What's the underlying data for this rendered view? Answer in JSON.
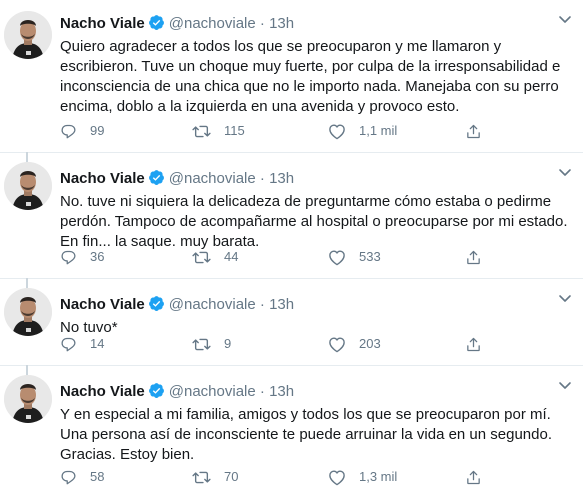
{
  "tweets": [
    {
      "name": "Nacho Viale",
      "handle": "@nachoviale",
      "dot": "·",
      "time": "13h",
      "text": "Quiero agradecer a todos los que se preocuparon y me llamaron y\nescribieron. Tuve un choque muy fuerte, por culpa de la irresponsabilidad e\ninconsciencia de una chica que no le importo nada. Manejaba con su perro\nencima, doblo a la izquierda en una avenida y provoco esto.",
      "replies": "99",
      "retweets": "115",
      "likes": "1,1 mil"
    },
    {
      "name": "Nacho Viale",
      "handle": "@nachoviale",
      "dot": "·",
      "time": "13h",
      "text": "No. tuve ni siquiera la delicadeza de preguntarme cómo estaba o pedirme\nperdón. Tampoco de acompañarme al hospital o preocuparse por mi estado.\nEn fin... la saque. muy barata.",
      "replies": "36",
      "retweets": "44",
      "likes": "533"
    },
    {
      "name": "Nacho Viale",
      "handle": "@nachoviale",
      "dot": "·",
      "time": "13h",
      "text": "No tuvo*",
      "replies": "14",
      "retweets": "9",
      "likes": "203"
    },
    {
      "name": "Nacho Viale",
      "handle": "@nachoviale",
      "dot": "·",
      "time": "13h",
      "text": "Y en especial a mi familia, amigos y todos los que se preocuparon por mí.\nUna persona así de inconsciente te puede arruinar la vida en un segundo.\nGracias.  Estoy bien.",
      "replies": "58",
      "retweets": "70",
      "likes": "1,3 mil"
    }
  ],
  "icons": {
    "avatar": "profile-photo",
    "verified": "verified-badge-icon",
    "caret": "chevron-down-icon",
    "reply": "comment-icon",
    "retweet": "retweet-icon",
    "like": "heart-icon",
    "share": "share-icon"
  },
  "colors": {
    "text": "#14171a",
    "secondary": "#657786",
    "verified": "#1da1f2",
    "divider": "#e6ecf0",
    "thread_line": "#ccd6dd"
  }
}
